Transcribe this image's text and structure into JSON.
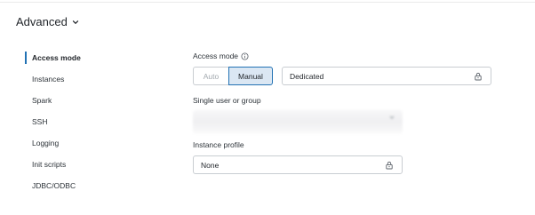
{
  "section": {
    "title": "Advanced"
  },
  "sidebar": {
    "items": [
      {
        "label": "Access mode",
        "active": true
      },
      {
        "label": "Instances",
        "active": false
      },
      {
        "label": "Spark",
        "active": false
      },
      {
        "label": "SSH",
        "active": false
      },
      {
        "label": "Logging",
        "active": false
      },
      {
        "label": "Init scripts",
        "active": false
      },
      {
        "label": "JDBC/ODBC",
        "active": false
      }
    ]
  },
  "access_mode": {
    "label": "Access mode",
    "toggle": {
      "options": [
        "Auto",
        "Manual"
      ],
      "selected": "Manual"
    },
    "value": "Dedicated"
  },
  "single_user": {
    "label": "Single user or group",
    "value": ""
  },
  "instance_profile": {
    "label": "Instance profile",
    "value": "None"
  },
  "colors": {
    "accent": "#2272b4",
    "border": "#c9cdd2",
    "selected_bg": "#dbe7f3"
  }
}
